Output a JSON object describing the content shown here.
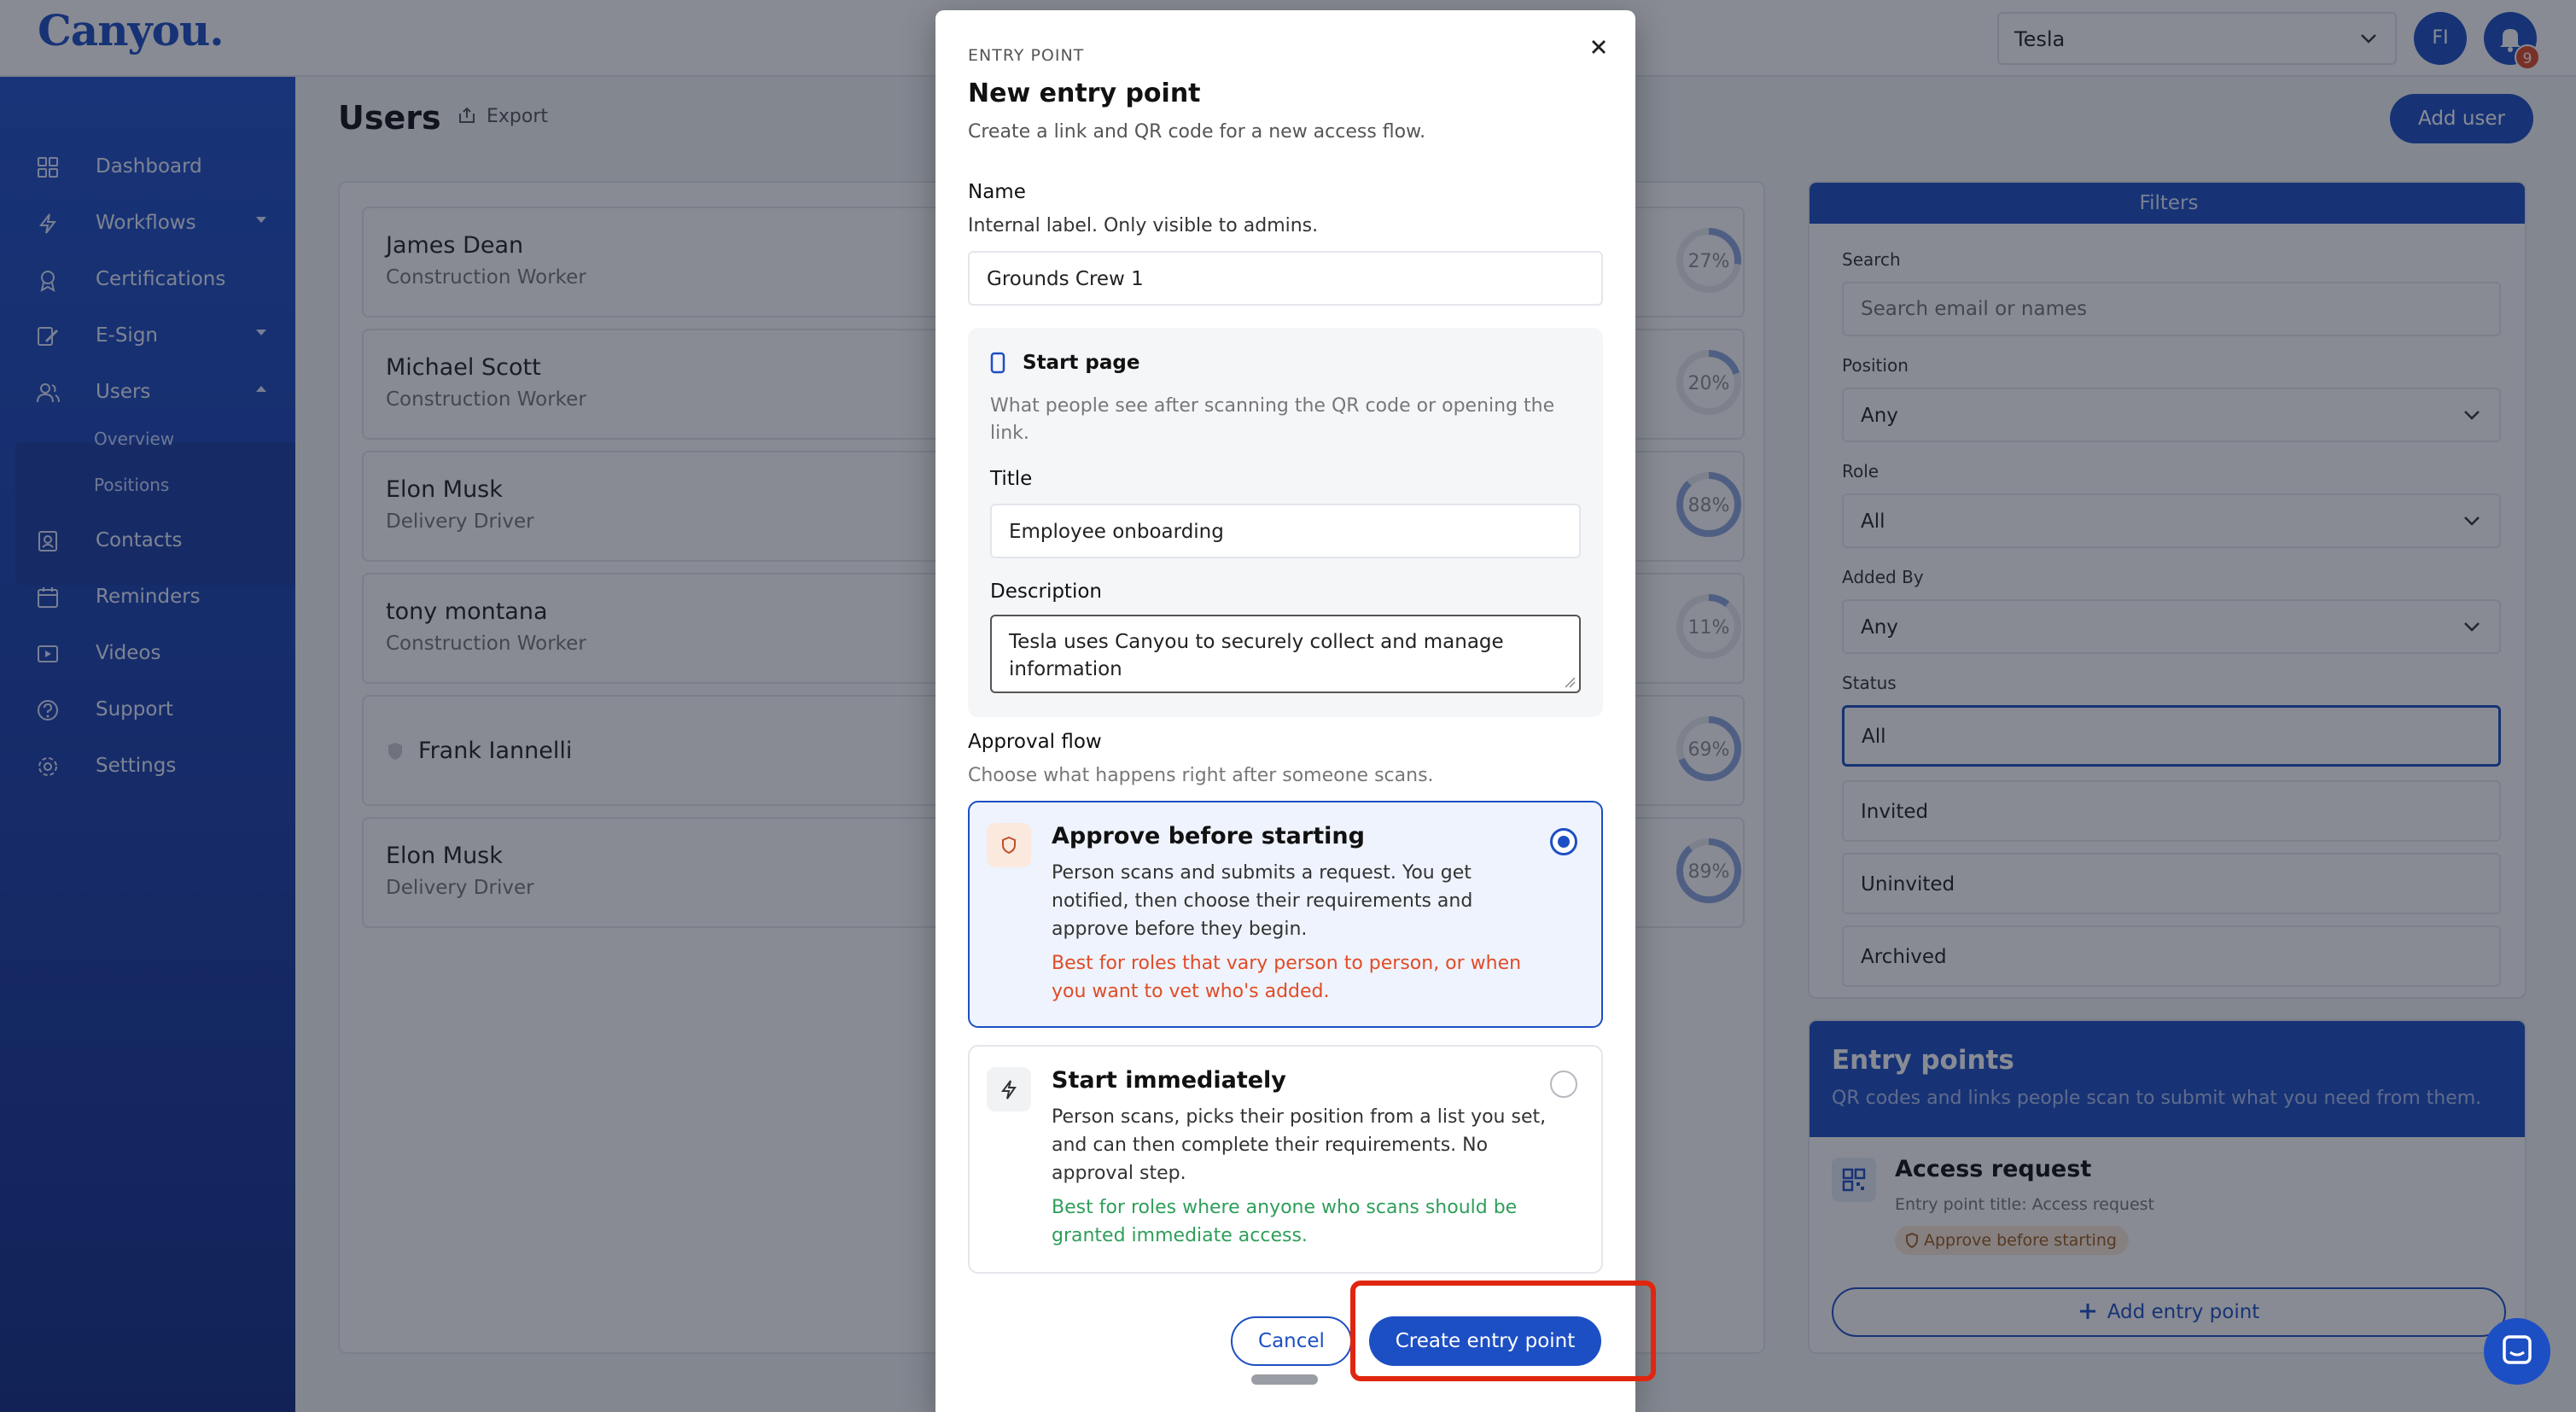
{
  "app": {
    "logo": "Canyou.",
    "tenant": "Tesla",
    "avatar_initials": "FI",
    "notifications": "9"
  },
  "sidebar": {
    "items": [
      {
        "label": "Dashboard",
        "icon": "dashboard-icon"
      },
      {
        "label": "Workflows",
        "icon": "bolt-icon"
      },
      {
        "label": "Certifications",
        "icon": "award-icon"
      },
      {
        "label": "E-Sign",
        "icon": "signature-icon"
      },
      {
        "label": "Users",
        "icon": "users-icon"
      },
      {
        "label": "Contacts",
        "icon": "contacts-icon"
      },
      {
        "label": "Reminders",
        "icon": "calendar-icon"
      },
      {
        "label": "Videos",
        "icon": "video-icon"
      },
      {
        "label": "Support",
        "icon": "help-icon"
      },
      {
        "label": "Settings",
        "icon": "gear-icon"
      }
    ],
    "users_sub": [
      "Overview",
      "Positions"
    ]
  },
  "main": {
    "title": "Users",
    "export": "Export",
    "add_user": "Add user",
    "users": [
      {
        "name": "James Dean",
        "position": "Construction Worker",
        "progress": "27%",
        "value": 27
      },
      {
        "name": "Michael Scott",
        "position": "Construction Worker",
        "progress": "20%",
        "value": 20
      },
      {
        "name": "Elon Musk",
        "position": "Delivery Driver",
        "progress": "88%",
        "value": 88
      },
      {
        "name": "tony montana",
        "position": "Construction Worker",
        "progress": "11%",
        "value": 11
      },
      {
        "name": "Frank Iannelli",
        "position": "",
        "progress": "69%",
        "value": 69
      },
      {
        "name": "Elon Musk",
        "position": "Delivery Driver",
        "progress": "89%",
        "value": 89
      }
    ]
  },
  "filters": {
    "header": "Filters",
    "search_label": "Search",
    "search_placeholder": "Search email or names",
    "position_label": "Position",
    "position_value": "Any",
    "role_label": "Role",
    "role_value": "All",
    "added_by_label": "Added By",
    "added_by_value": "Any",
    "status_label": "Status",
    "status_options": [
      "All",
      "Invited",
      "Uninvited",
      "Archived"
    ]
  },
  "entry_points": {
    "title": "Entry points",
    "subtitle": "QR codes and links people scan to submit what you need from them.",
    "item_title": "Access request",
    "item_subtitle": "Entry point title: Access request",
    "item_badge": "Approve before starting",
    "add_button": "Add entry point"
  },
  "modal": {
    "eyebrow": "ENTRY POINT",
    "title": "New entry point",
    "subtitle": "Create a link and QR code for a new access flow.",
    "name_label": "Name",
    "name_help": "Internal label. Only visible to admins.",
    "name_value": "Grounds Crew 1",
    "start_page_title": "Start page",
    "start_page_help": "What people see after scanning the QR code or opening the link.",
    "title_label": "Title",
    "title_value": "Employee onboarding",
    "description_label": "Description",
    "description_value": "Tesla uses Canyou to securely collect and manage information",
    "approval_label": "Approval flow",
    "approval_help": "Choose what happens right after someone scans.",
    "option1": {
      "title": "Approve before starting",
      "body": "Person scans and submits a request. You get notified, then choose their requirements and approve before they begin.",
      "note": "Best for roles that vary person to person, or when you want to vet who's added.",
      "selected": true
    },
    "option2": {
      "title": "Start immediately",
      "body": "Person scans, picks their position from a list you set, and can then complete their requirements. No approval step.",
      "note": "Best for roles where anyone who scans should be granted immediate access.",
      "selected": false
    },
    "cancel": "Cancel",
    "create": "Create entry point"
  },
  "colors": {
    "brand": "#1d4fc4",
    "warning": "#e14b26",
    "success": "#2f9e5a",
    "highlight": "#e0260f"
  }
}
